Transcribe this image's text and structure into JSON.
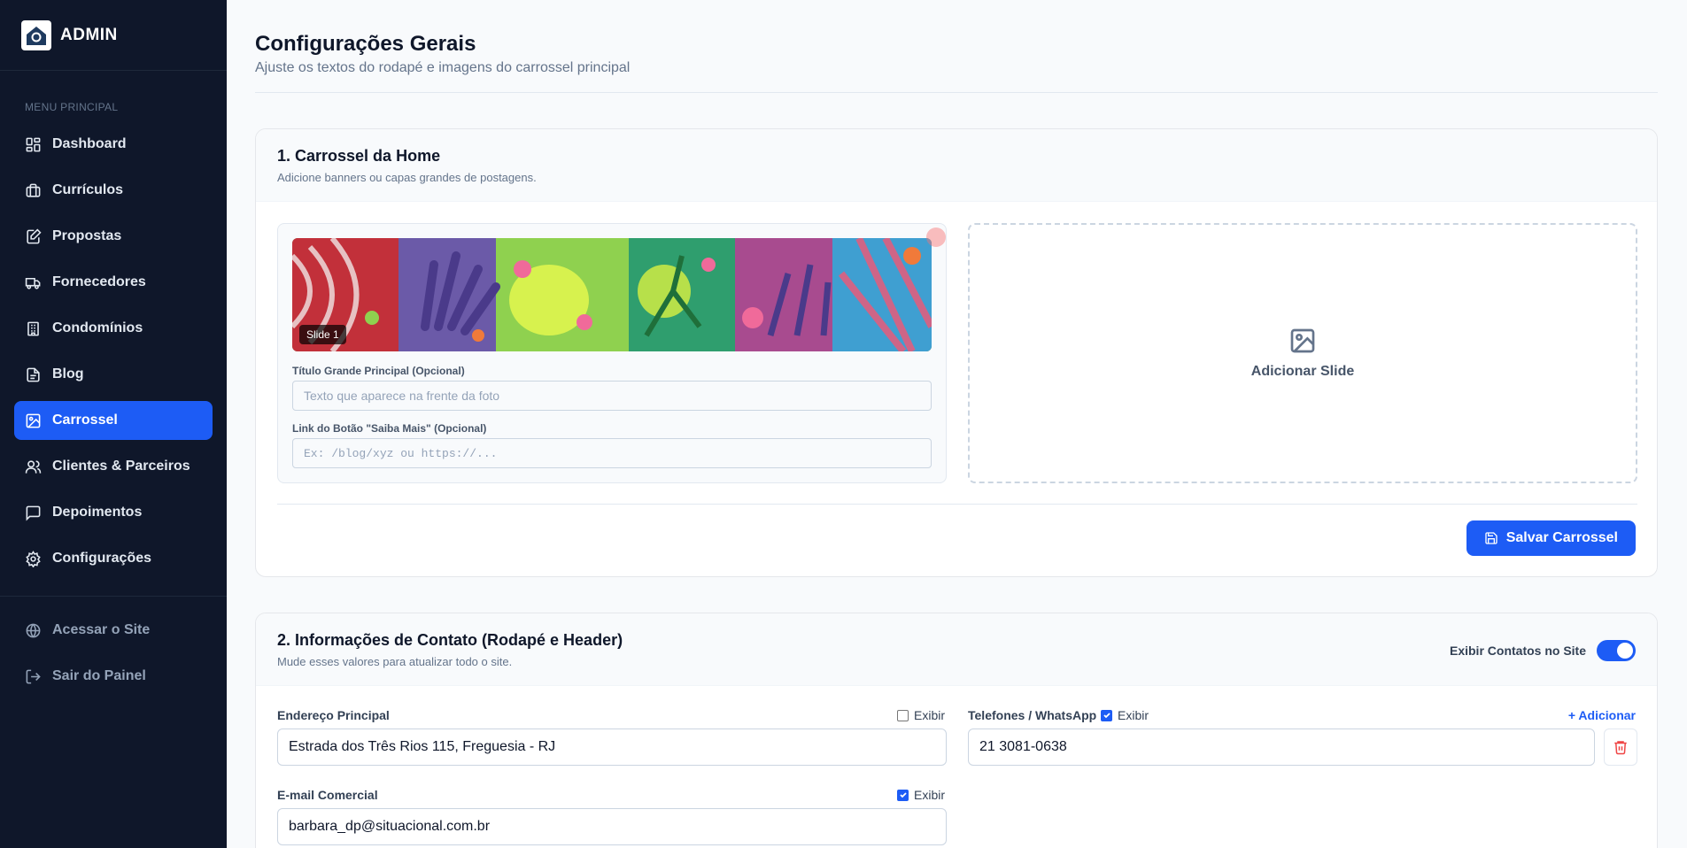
{
  "brand": {
    "title": "ADMIN"
  },
  "sidebar": {
    "menu_label": "MENU PRINCIPAL",
    "items": [
      {
        "label": "Dashboard",
        "icon": "dashboard-icon"
      },
      {
        "label": "Currículos",
        "icon": "briefcase-icon"
      },
      {
        "label": "Propostas",
        "icon": "edit-document-icon"
      },
      {
        "label": "Fornecedores",
        "icon": "truck-icon"
      },
      {
        "label": "Condomínios",
        "icon": "building-icon"
      },
      {
        "label": "Blog",
        "icon": "document-icon"
      },
      {
        "label": "Carrossel",
        "icon": "image-icon",
        "active": true
      },
      {
        "label": "Clientes & Parceiros",
        "icon": "users-icon"
      },
      {
        "label": "Depoimentos",
        "icon": "message-icon"
      },
      {
        "label": "Configurações",
        "icon": "gear-icon"
      }
    ],
    "footer": [
      {
        "label": "Acessar o Site",
        "icon": "globe-icon"
      },
      {
        "label": "Sair do Painel",
        "icon": "logout-icon"
      }
    ]
  },
  "page": {
    "title": "Configurações Gerais",
    "subtitle": "Ajuste os textos do rodapé e imagens do carrossel principal"
  },
  "carousel": {
    "title": "1. Carrossel da Home",
    "description": "Adicione banners ou capas grandes de postagens.",
    "slide": {
      "badge": "Slide 1",
      "title_label": "Título Grande Principal (Opcional)",
      "title_placeholder": "Texto que aparece na frente da foto",
      "title_value": "",
      "link_label": "Link do Botão \"Saiba Mais\" (Opcional)",
      "link_placeholder": "Ex: /blog/xyz ou https://...",
      "link_value": ""
    },
    "add_slide_label": "Adicionar Slide",
    "save_label": "Salvar Carrossel"
  },
  "contact": {
    "title": "2. Informações de Contato (Rodapé e Header)",
    "description": "Mude esses valores para atualizar todo o site.",
    "toggle_label": "Exibir Contatos no Site",
    "toggle_on": true,
    "address": {
      "label": "Endereço Principal",
      "show_label": "Exibir",
      "show": false,
      "value": "Estrada dos Três Rios 115, Freguesia - RJ"
    },
    "phones": {
      "label": "Telefones / WhatsApp",
      "show_label": "Exibir",
      "show": true,
      "add_label": "+ Adicionar",
      "items": [
        "21 3081-0638"
      ]
    },
    "email": {
      "label": "E-mail Comercial",
      "show_label": "Exibir",
      "show": true,
      "value": "barbara_dp@situacional.com.br"
    }
  },
  "colors": {
    "sidebar_bg": "#0f172a",
    "accent": "#1d5cf5",
    "danger": "#ef4444"
  }
}
